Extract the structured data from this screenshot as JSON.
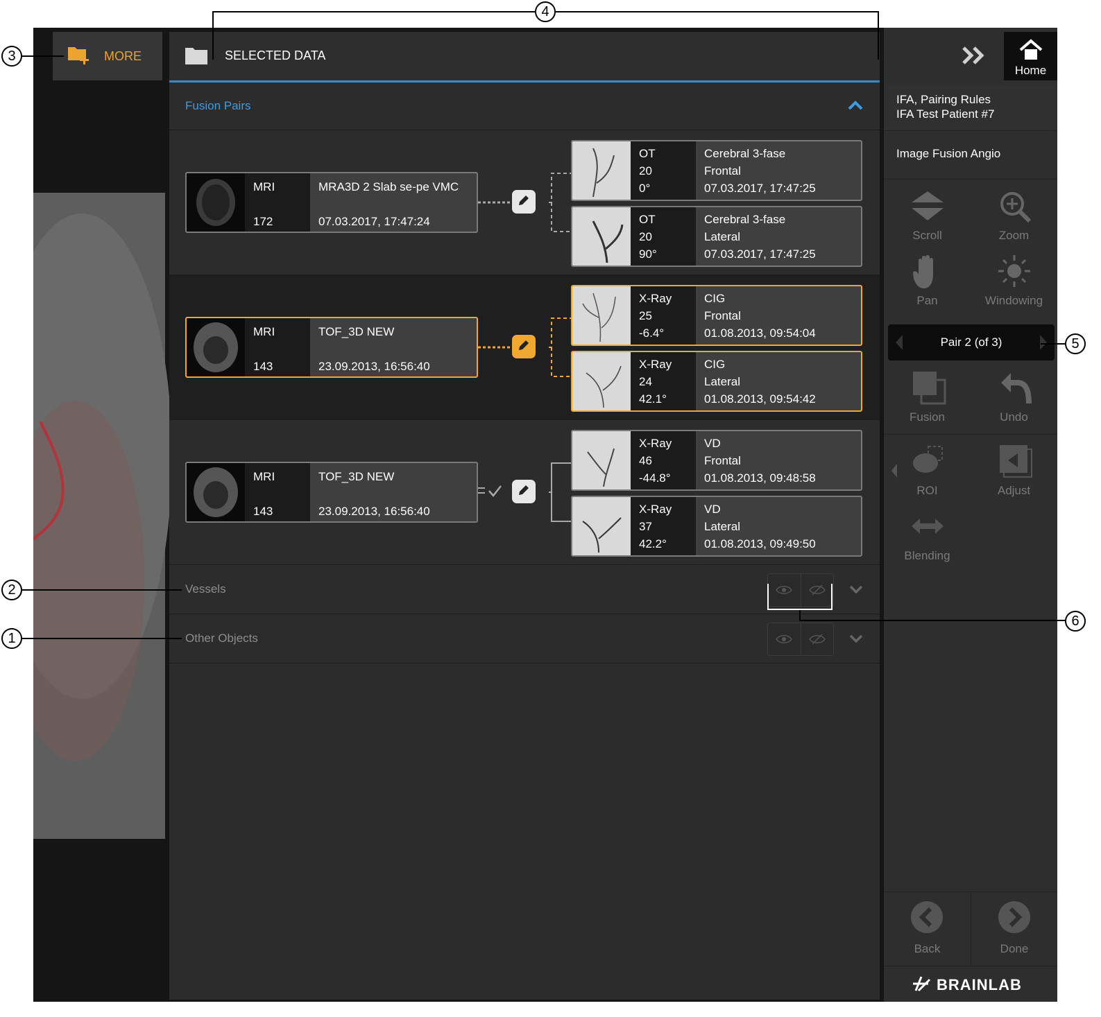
{
  "toolbar": {
    "more_label": "MORE",
    "selected_data_title": "SELECTED DATA"
  },
  "fusion_section": {
    "label": "Fusion Pairs"
  },
  "pairs": [
    {
      "mri": {
        "modality": "MRI",
        "count": "172",
        "name": "MRA3D 2 Slab se-pe VMC",
        "date": "07.03.2017, 17:47:24"
      },
      "angios": [
        {
          "modality": "OT",
          "count": "20",
          "angle": "0°",
          "name": "Cerebral 3-fase",
          "view": "Frontal",
          "date": "07.03.2017, 17:47:25"
        },
        {
          "modality": "OT",
          "count": "20",
          "angle": "90°",
          "name": "Cerebral 3-fase",
          "view": "Lateral",
          "date": "07.03.2017, 17:47:25"
        }
      ]
    },
    {
      "mri": {
        "modality": "MRI",
        "count": "143",
        "name": "TOF_3D NEW",
        "date": "23.09.2013, 16:56:40"
      },
      "angios": [
        {
          "modality": "X-Ray",
          "count": "25",
          "angle": "-6.4°",
          "name": "CIG",
          "view": "Frontal",
          "date": "01.08.2013, 09:54:04"
        },
        {
          "modality": "X-Ray",
          "count": "24",
          "angle": "42.1°",
          "name": "CIG",
          "view": "Lateral",
          "date": "01.08.2013, 09:54:42"
        }
      ]
    },
    {
      "mri": {
        "modality": "MRI",
        "count": "143",
        "name": "TOF_3D NEW",
        "date": "23.09.2013, 16:56:40"
      },
      "angios": [
        {
          "modality": "X-Ray",
          "count": "46",
          "angle": "-44.8°",
          "name": "VD",
          "view": "Frontal",
          "date": "01.08.2013, 09:48:58"
        },
        {
          "modality": "X-Ray",
          "count": "37",
          "angle": "42.2°",
          "name": "VD",
          "view": "Lateral",
          "date": "01.08.2013, 09:49:50"
        }
      ]
    }
  ],
  "vessels_section": {
    "label": "Vessels"
  },
  "other_section": {
    "label": "Other Objects"
  },
  "sidebar": {
    "home_label": "Home",
    "patient_line1": "IFA, Pairing Rules",
    "patient_line2": "IFA Test Patient #7",
    "workflow": "Image Fusion Angio",
    "tools": {
      "scroll": "Scroll",
      "zoom": "Zoom",
      "pan": "Pan",
      "windowing": "Windowing",
      "fusion": "Fusion",
      "undo": "Undo",
      "roi": "ROI",
      "adjust": "Adjust",
      "blending": "Blending"
    },
    "pair_nav": "Pair 2 (of 3)",
    "back": "Back",
    "done": "Done",
    "brand": "BRAINLAB"
  },
  "callouts": {
    "c1": "1",
    "c2": "2",
    "c3": "3",
    "c4": "4",
    "c5": "5",
    "c6": "6"
  },
  "colors": {
    "accent_orange": "#f0a830",
    "accent_blue": "#2f8dd2",
    "panel": "#2c2c2c"
  }
}
